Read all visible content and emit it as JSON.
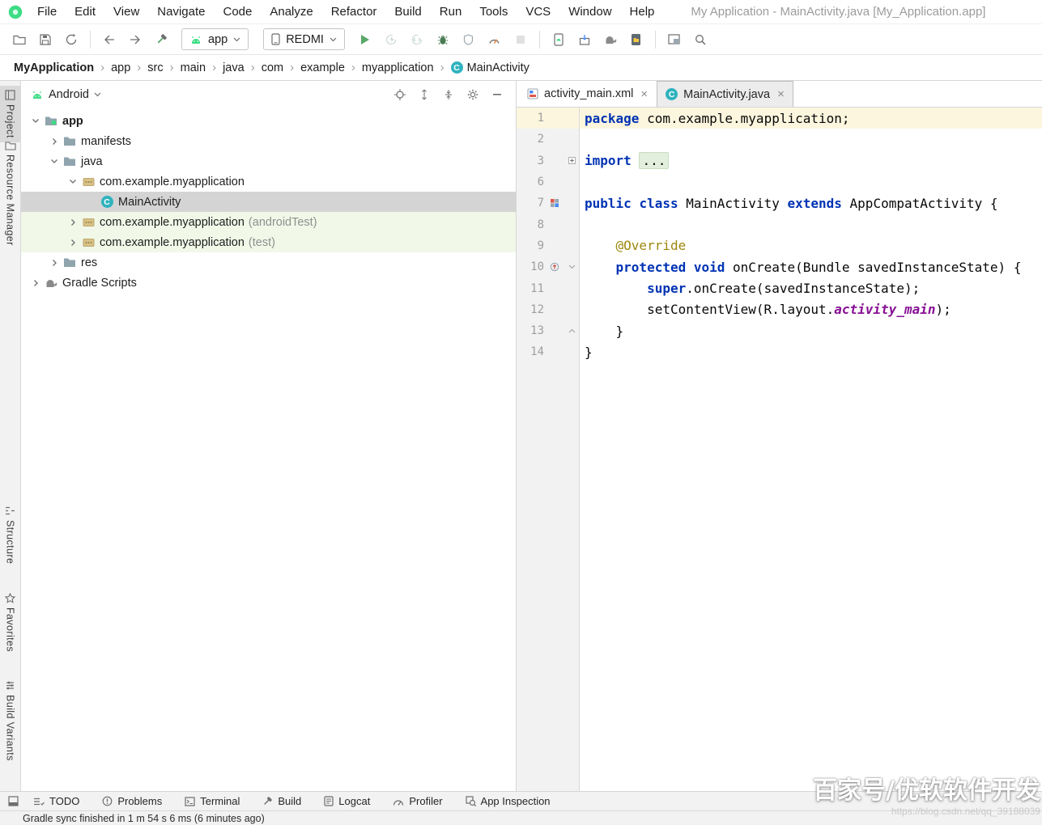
{
  "window": {
    "title": "My Application - MainActivity.java [My_Application.app]"
  },
  "menu": {
    "items": [
      "File",
      "Edit",
      "View",
      "Navigate",
      "Code",
      "Analyze",
      "Refactor",
      "Build",
      "Run",
      "Tools",
      "VCS",
      "Window",
      "Help"
    ]
  },
  "toolbar": {
    "items": [
      {
        "type": "icon",
        "name": "open-icon"
      },
      {
        "type": "icon",
        "name": "save-icon"
      },
      {
        "type": "icon",
        "name": "sync-icon"
      },
      {
        "type": "sep"
      },
      {
        "type": "icon",
        "name": "back-icon"
      },
      {
        "type": "icon",
        "name": "forward-icon"
      },
      {
        "type": "icon",
        "name": "build-hammer-icon"
      },
      {
        "type": "combo",
        "name": "run-config-select",
        "icon": "android-head",
        "label": "app"
      },
      {
        "type": "combo",
        "name": "device-select",
        "icon": "phone-icon",
        "label": "REDMI"
      },
      {
        "type": "icon",
        "name": "run-icon"
      },
      {
        "type": "icon",
        "name": "apply-changes-icon",
        "disabled": true
      },
      {
        "type": "icon",
        "name": "apply-code-changes-icon",
        "disabled": true
      },
      {
        "type": "icon",
        "name": "debug-icon"
      },
      {
        "type": "icon",
        "name": "run-coverage-icon"
      },
      {
        "type": "icon",
        "name": "profile-icon"
      },
      {
        "type": "icon",
        "name": "stop-icon",
        "disabled": true
      },
      {
        "type": "sep"
      },
      {
        "type": "icon",
        "name": "avd-manager-icon"
      },
      {
        "type": "icon",
        "name": "sdk-manager-icon"
      },
      {
        "type": "icon",
        "name": "gradle-sync-icon"
      },
      {
        "type": "icon",
        "name": "device-file-explorer-icon"
      },
      {
        "type": "sep"
      },
      {
        "type": "icon",
        "name": "layout-inspector-icon"
      },
      {
        "type": "icon",
        "name": "search-icon"
      }
    ]
  },
  "breadcrumbs": {
    "items": [
      "MyApplication",
      "app",
      "src",
      "main",
      "java",
      "com",
      "example",
      "myapplication",
      "MainActivity"
    ]
  },
  "left_stripe": {
    "items": [
      {
        "label": "Project",
        "icon": "stripe-project-icon",
        "active": true
      },
      {
        "label": "Resource Manager",
        "icon": "stripe-folder-icon"
      },
      {
        "label": "Structure",
        "icon": "stripe-structure-icon"
      },
      {
        "label": "Favorites",
        "icon": "stripe-star-icon"
      },
      {
        "label": "Build Variants",
        "icon": "stripe-variants-icon"
      }
    ]
  },
  "project_panel": {
    "view_label": "Android",
    "header_icons": [
      "locate-icon",
      "expand-all-icon",
      "collapse-all-icon",
      "settings-icon",
      "hide-icon"
    ],
    "tree": [
      {
        "label": "app",
        "icon": "app-folder",
        "chevron": "down",
        "level": 0,
        "bold": true
      },
      {
        "label": "manifests",
        "icon": "folder",
        "chevron": "right",
        "level": 1
      },
      {
        "label": "java",
        "icon": "folder",
        "chevron": "down",
        "level": 1
      },
      {
        "label": "com.example.myapplication",
        "icon": "package",
        "chevron": "down",
        "level": 2
      },
      {
        "label": "MainActivity",
        "icon": "class",
        "level": 3,
        "selected": true
      },
      {
        "label": "com.example.myapplication",
        "suffix": "(androidTest)",
        "icon": "package",
        "chevron": "right",
        "level": 2,
        "tint": "green"
      },
      {
        "label": "com.example.myapplication",
        "suffix": "(test)",
        "icon": "package",
        "chevron": "right",
        "level": 2,
        "tint": "green"
      },
      {
        "label": "res",
        "icon": "folder",
        "chevron": "right",
        "level": 1
      },
      {
        "label": "Gradle Scripts",
        "icon": "gradle",
        "chevron": "right",
        "level": 0
      }
    ]
  },
  "editor": {
    "tabs": [
      {
        "label": "activity_main.xml",
        "icon": "layout-file",
        "active": false
      },
      {
        "label": "MainActivity.java",
        "icon": "class",
        "active": true
      }
    ],
    "code": {
      "lines": [
        {
          "num": "1",
          "current": true,
          "segs": [
            [
              "kw",
              "package"
            ],
            [
              "pl",
              " com.example.myapplication;"
            ]
          ]
        },
        {
          "num": "2",
          "segs": []
        },
        {
          "num": "3",
          "fold": "fold-plus",
          "segs": [
            [
              "kw",
              "import"
            ],
            [
              "pl",
              " "
            ],
            [
              "fold",
              "..."
            ]
          ]
        },
        {
          "num": "6",
          "segs": []
        },
        {
          "num": "7",
          "gicon": "related-resource-gutter-icon",
          "segs": [
            [
              "kw",
              "public"
            ],
            [
              "pl",
              " "
            ],
            [
              "kw",
              "class"
            ],
            [
              "pl",
              " MainActivity "
            ],
            [
              "kw",
              "extends"
            ],
            [
              "pl",
              " AppCompatActivity {"
            ]
          ]
        },
        {
          "num": "8",
          "segs": []
        },
        {
          "num": "9",
          "segs": [
            [
              "pl",
              "    "
            ],
            [
              "an",
              "@Override"
            ]
          ]
        },
        {
          "num": "10",
          "gicon": "override-gutter-icon",
          "fold": "fold-down",
          "segs": [
            [
              "pl",
              "    "
            ],
            [
              "kw",
              "protected"
            ],
            [
              "pl",
              " "
            ],
            [
              "kw",
              "void"
            ],
            [
              "pl",
              " onCreate(Bundle savedInstanceState) {"
            ]
          ]
        },
        {
          "num": "11",
          "segs": [
            [
              "pl",
              "        "
            ],
            [
              "kw",
              "super"
            ],
            [
              "pl",
              ".onCreate(savedInstanceState);"
            ]
          ]
        },
        {
          "num": "12",
          "segs": [
            [
              "pl",
              "        setContentView(R.layout."
            ],
            [
              "fd",
              "activity_main"
            ],
            [
              "pl",
              ");"
            ]
          ]
        },
        {
          "num": "13",
          "fold": "fold-up",
          "segs": [
            [
              "pl",
              "    }"
            ]
          ]
        },
        {
          "num": "14",
          "segs": [
            [
              "pl",
              "}"
            ]
          ]
        }
      ]
    }
  },
  "bottom_bar": {
    "items": [
      {
        "label": "TODO",
        "icon": "todo-icon"
      },
      {
        "label": "Problems",
        "icon": "problems-icon"
      },
      {
        "label": "Terminal",
        "icon": "terminal-icon"
      },
      {
        "label": "Build",
        "icon": "build-icon"
      },
      {
        "label": "Logcat",
        "icon": "logcat-icon"
      },
      {
        "label": "Profiler",
        "icon": "profiler-icon"
      },
      {
        "label": "App Inspection",
        "icon": "inspection-icon"
      }
    ]
  },
  "status_bar": {
    "message": "Gradle sync finished in 1 m 54 s 6 ms (6 minutes ago)"
  },
  "watermark": {
    "line1": "百家号/优软软件开发",
    "line2": "https://blog.csdn.net/qq_39188039"
  },
  "colors": {
    "keyword": "#0033B3",
    "annotation": "#9E880D",
    "static_member": "#871094",
    "current_line": "#FCF6DE",
    "selection": "#D4D4D4",
    "test_source_row": "#F1F8E8",
    "run_green": "#59A869",
    "class_icon_teal": "#2FB3BE",
    "android_green": "#3DDC84"
  }
}
